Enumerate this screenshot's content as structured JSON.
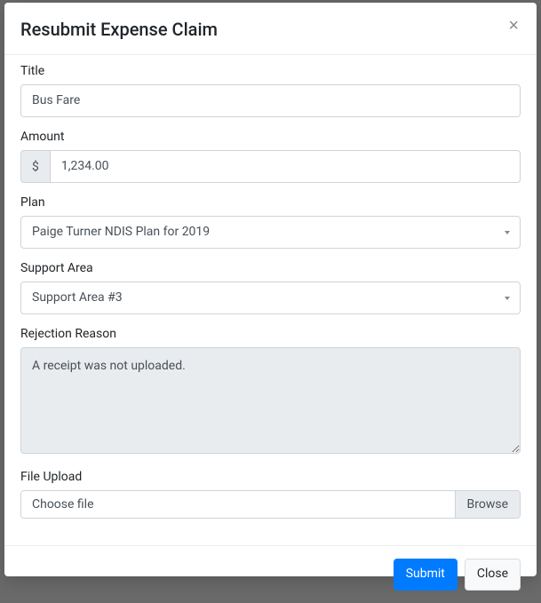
{
  "modal": {
    "title": "Resubmit Expense Claim",
    "close_symbol": "×"
  },
  "form": {
    "title": {
      "label": "Title",
      "value": "Bus Fare"
    },
    "amount": {
      "label": "Amount",
      "currency_symbol": "$",
      "value": "1,234.00"
    },
    "plan": {
      "label": "Plan",
      "selected": "Paige Turner NDIS Plan for 2019"
    },
    "support_area": {
      "label": "Support Area",
      "selected": "Support Area #3"
    },
    "rejection_reason": {
      "label": "Rejection Reason",
      "value": "A receipt was not uploaded."
    },
    "file_upload": {
      "label": "File Upload",
      "placeholder": "Choose file",
      "browse_label": "Browse"
    }
  },
  "footer": {
    "submit_label": "Submit",
    "close_label": "Close"
  }
}
